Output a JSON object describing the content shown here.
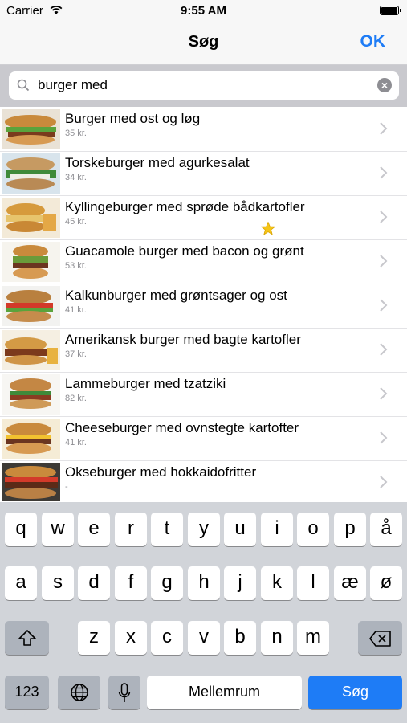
{
  "status": {
    "carrier": "Carrier",
    "time": "9:55 AM"
  },
  "nav": {
    "title": "Søg",
    "ok": "OK"
  },
  "search": {
    "query": "burger med"
  },
  "items": [
    {
      "name": "Burger med ost og løg",
      "price": "35 kr."
    },
    {
      "name": "Torskeburger med agurkesalat",
      "price": "34 kr."
    },
    {
      "name": "Kyllingeburger med sprøde bådkartofler",
      "price": "45 kr.",
      "favorite": true
    },
    {
      "name": "Guacamole burger med bacon og grønt",
      "price": "53 kr."
    },
    {
      "name": "Kalkunburger med grøntsager og ost",
      "price": "41 kr."
    },
    {
      "name": "Amerikansk burger med bagte kartofler",
      "price": "37 kr."
    },
    {
      "name": "Lammeburger med tzatziki",
      "price": "82 kr."
    },
    {
      "name": "Cheeseburger med ovnstegte kartofter",
      "price": "41 kr."
    },
    {
      "name": "Okseburger med hokkaidofritter",
      "price": "-"
    }
  ],
  "keyboard": {
    "row1": [
      "q",
      "w",
      "e",
      "r",
      "t",
      "y",
      "u",
      "i",
      "o",
      "p",
      "å"
    ],
    "row2": [
      "a",
      "s",
      "d",
      "f",
      "g",
      "h",
      "j",
      "k",
      "l",
      "æ",
      "ø"
    ],
    "row3": [
      "z",
      "x",
      "c",
      "v",
      "b",
      "n",
      "m"
    ],
    "numbers": "123",
    "space": "Mellemrum",
    "go": "Søg"
  },
  "icons": {
    "wifi": "wifi-icon",
    "battery": "battery-icon",
    "search": "search-icon",
    "clear": "clear-icon",
    "chevron": "chevron-right-icon",
    "star": "star-icon",
    "shift": "shift-icon",
    "backspace": "backspace-icon",
    "globe": "globe-icon",
    "mic": "microphone-icon"
  },
  "colors": {
    "accent": "#1e7cf6",
    "star": "#f5c518"
  }
}
